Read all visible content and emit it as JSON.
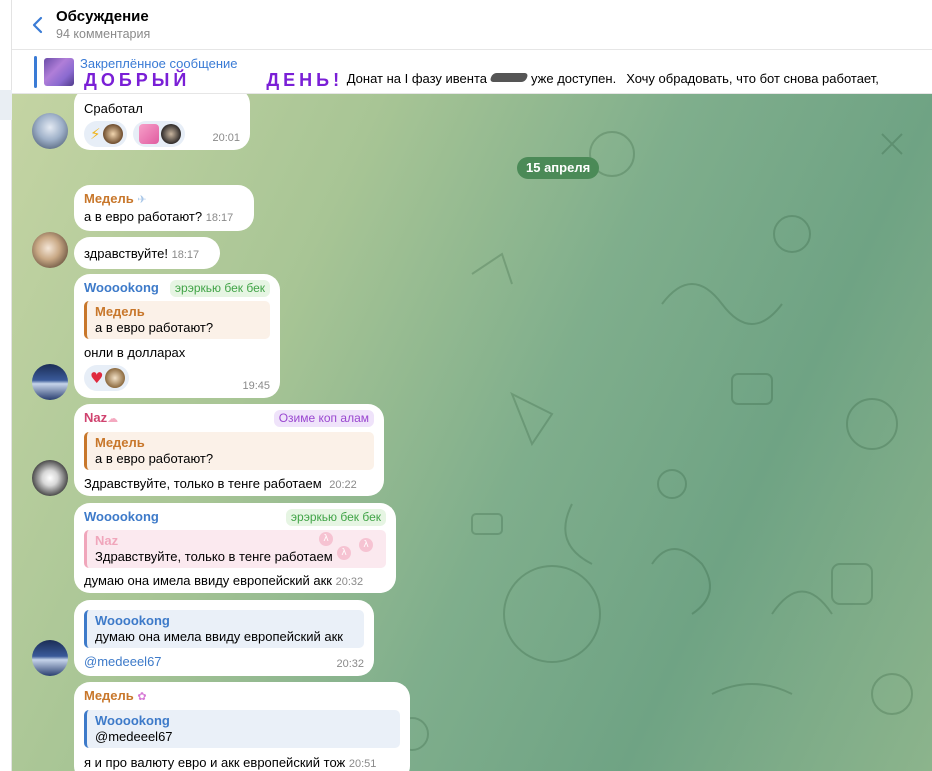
{
  "header": {
    "title": "Обсуждение",
    "subtitle": "94 комментария"
  },
  "pinned": {
    "label": "Закреплённое сообщение",
    "big_word_1": "ДОБРЫЙ",
    "big_word_2": "ДЕНЬ!",
    "text_part_1": "Донат на I фазу ивента",
    "text_part_2": "уже доступен.",
    "text_part_3": "Хочу обрадовать, что бот снова работает,"
  },
  "date_separator": "15 апреля",
  "messages": [
    {
      "text": "Сработал",
      "time": "20:01",
      "reactions": [
        {
          "emoji_icon": "lightning-icon",
          "emoji": "⚡"
        },
        {
          "emoji_icon": "pink-sticker-icon",
          "emoji": ""
        }
      ]
    },
    {
      "sender": "Медель",
      "text": "а в евро работают?",
      "time": "18:17"
    },
    {
      "text": "здравствуйте!",
      "time": "18:17"
    },
    {
      "sender": "Wooookong",
      "badge": "эрэркью бек бек",
      "quote": {
        "name": "Медель",
        "text": "а в евро работают?"
      },
      "text": "онли в долларах",
      "time": "19:45",
      "reactions": [
        {
          "emoji_icon": "heart-icon",
          "emoji": "♥"
        }
      ]
    },
    {
      "sender": "Naz",
      "badge": "Озиме коп алам",
      "quote": {
        "name": "Медель",
        "text": "а в евро работают?"
      },
      "text": "Здравствуйте, только в тенге работаем",
      "time": "20:22"
    },
    {
      "sender": "Wooookong",
      "badge": "эрэркью бек бек",
      "quote": {
        "name": "Naz",
        "text": "Здравствуйте, только в тенге работаем"
      },
      "text": "думаю она имела ввиду европейский акк",
      "time": "20:32"
    },
    {
      "quote": {
        "name": "Wooookong",
        "text": "думаю она имела ввиду европейский акк"
      },
      "text": "@medeeel67",
      "time": "20:32"
    },
    {
      "sender": "Медель",
      "quote": {
        "name": "Wooookong",
        "text": "@medeeel67"
      },
      "text": "я и про валюту евро и акк европейский тож",
      "time": "20:51"
    }
  ],
  "colors": {
    "accent": "#3a7bd5",
    "date_pill": "#4b8a57",
    "medel": "#c8772b",
    "wooookong": "#3d7ac9",
    "naz": "#d0436f",
    "pinned_big": "#7a1fd6"
  }
}
